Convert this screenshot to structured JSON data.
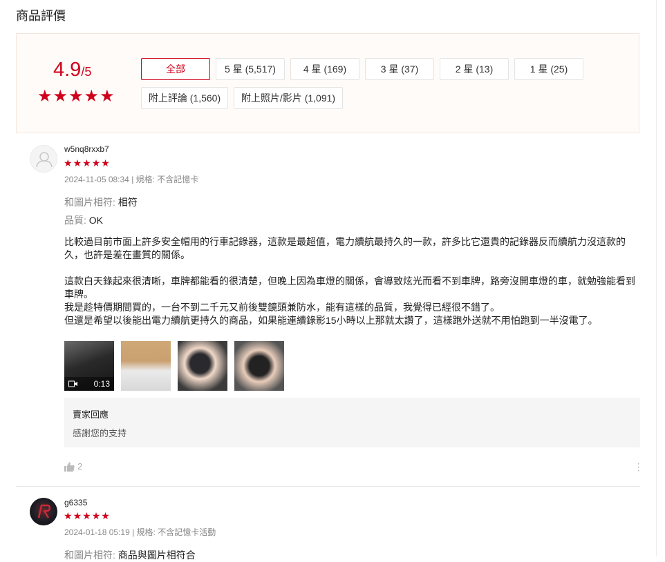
{
  "section": {
    "title": "商品評價"
  },
  "summary": {
    "rating": "4.9",
    "rating_suffix": "/5",
    "filters": [
      "全部",
      "5 星 (5,517)",
      "4 星 (169)",
      "3 星 (37)",
      "2 星 (13)",
      "1 星 (25)",
      "附上評論 (1,560)",
      "附上照片/影片 (1,091)"
    ],
    "active_filter": "全部",
    "star_count": 5
  },
  "reviews": [
    {
      "username": "w5nq8rxxb7",
      "stars": 5,
      "meta": "2024-11-05 08:34 | 規格: 不含記憶卡",
      "attributes": [
        {
          "key": "和圖片相符:",
          "value": "相符"
        },
        {
          "key": "品質:",
          "value": "OK"
        }
      ],
      "paragraphs": [
        "比較過目前市面上許多安全帽用的行車記錄器，這款是最超值，電力續航最持久的一款，許多比它還貴的記錄器反而續航力沒這款的久，也許是差在畫質的關係。",
        "",
        "這款白天錄起來很清晰，車牌都能看的很清楚，但晚上因為車燈的關係，會導致炫光而看不到車牌，路旁沒開車燈的車，就勉強能看到車牌。",
        "我是趁特價期間買的，一台不到二千元又前後雙鏡頭兼防水，能有這樣的品質，我覺得已經很不錯了。",
        "但還是希望以後能出電力續航更持久的商品，如果能連續錄影15小時以上那就太讚了，這樣跑外送就不用怕跑到一半沒電了。"
      ],
      "video_duration": "0:13",
      "seller_reply": {
        "heading": "賣家回應",
        "content": "感謝您的支持"
      },
      "likes": "2"
    },
    {
      "username": "g6335",
      "stars": 5,
      "meta": "2024-01-18 05:19 | 規格: 不含記憶卡活動",
      "attributes": [
        {
          "key": "和圖片相符:",
          "value": "商品與圖片相符合"
        }
      ]
    }
  ],
  "colors": {
    "accent": "#d0011b",
    "summary_bg": "#fffbf8"
  }
}
